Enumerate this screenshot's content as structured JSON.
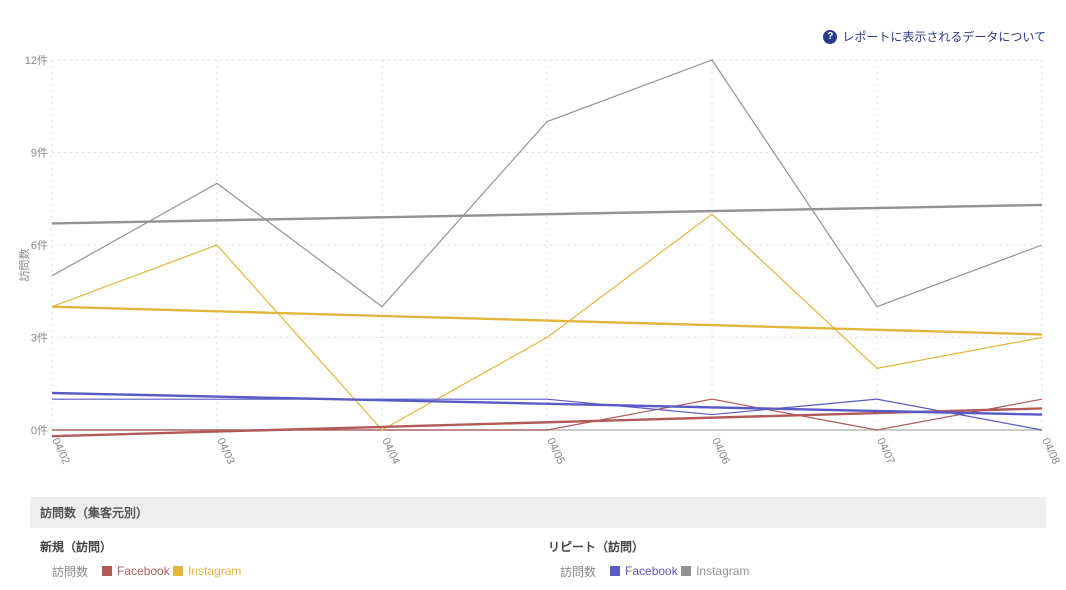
{
  "help_link": "レポートに表示されるデータについて",
  "yaxis": {
    "label": "訪問数",
    "ticks": [
      0,
      3,
      6,
      9,
      12
    ],
    "tick_suffix": "件"
  },
  "footer": {
    "bar_title": "訪問数（集客元別）",
    "left": {
      "title": "新規（訪問）",
      "metric_label": "訪問数",
      "items": [
        {
          "name": "Facebook",
          "color": "#B15A58"
        },
        {
          "name": "Instagram",
          "color": "#E0B63C"
        }
      ]
    },
    "right": {
      "title": "リピート（訪問）",
      "metric_label": "訪問数",
      "items": [
        {
          "name": "Facebook",
          "color": "#5A5AC6"
        },
        {
          "name": "Instagram",
          "color": "#939393"
        }
      ]
    }
  },
  "chart_data": {
    "type": "line",
    "title": "",
    "xlabel": "",
    "ylabel": "訪問数",
    "ylim": [
      0,
      12
    ],
    "y_tick_suffix": "件",
    "categories": [
      "04/02",
      "04/03",
      "04/04",
      "04/05",
      "04/06",
      "04/07",
      "04/08"
    ],
    "series": [
      {
        "name": "新規 Facebook",
        "color": "#B15A58",
        "values": [
          0,
          0,
          0,
          0,
          1,
          0,
          1
        ]
      },
      {
        "name": "新規 Instagram",
        "color": "#E0B63C",
        "values": [
          4,
          6,
          0,
          3,
          7,
          2,
          3
        ]
      },
      {
        "name": "リピート Facebook",
        "color": "#5A5AC6",
        "values": [
          1,
          1,
          1,
          1,
          0.5,
          1,
          0
        ]
      },
      {
        "name": "リピート Instagram",
        "color": "#939393",
        "values": [
          5,
          8,
          4,
          10,
          12,
          4,
          6
        ]
      }
    ],
    "trend_lines": [
      {
        "name": "新規 Facebook trend",
        "color": "#B15A58",
        "start": -0.2,
        "end": 0.7
      },
      {
        "name": "新規 Instagram trend",
        "color": "#E0B63C",
        "start": 4.0,
        "end": 3.1
      },
      {
        "name": "リピート Facebook trend",
        "color": "#5A5AC6",
        "start": 1.2,
        "end": 0.5
      },
      {
        "name": "リピート Instagram trend",
        "color": "#939393",
        "start": 6.7,
        "end": 7.3
      }
    ]
  }
}
